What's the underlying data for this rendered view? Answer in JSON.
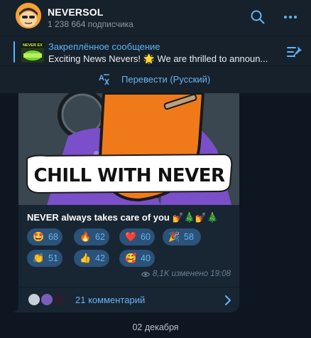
{
  "header": {
    "title": "NEVERSOL",
    "subtitle": "1 238 664 подписчика",
    "avatar_icon": "cartoon-avatar",
    "search_icon": "search-icon",
    "more_icon": "more-icon"
  },
  "pinned": {
    "label": "Закреплённое сообщение",
    "text": "Exciting News Nevers! 🌟  We are thrilled to announ...",
    "thumb_text": "NEVER EX"
  },
  "translate": {
    "label": "Перевести (Русский)"
  },
  "message": {
    "image_text": "CHILL WITH NEVER",
    "caption": "NEVER always takes care of you",
    "caption_emoji": "💅🎄💅🎄",
    "reactions": [
      {
        "emoji": "🤩",
        "count": "68"
      },
      {
        "emoji": "🔥",
        "count": "62"
      },
      {
        "emoji": "❤️",
        "count": "60"
      },
      {
        "emoji": "🎉",
        "count": "58"
      },
      {
        "emoji": "👏",
        "count": "51"
      },
      {
        "emoji": "👍",
        "count": "42"
      },
      {
        "emoji": "🥰",
        "count": "40"
      }
    ],
    "meta": "8,1K изменено 19:08",
    "comments": "21 комментарий"
  },
  "date_separator": "02 декабря",
  "colors": {
    "background": "#0e1621",
    "panel": "#17212b",
    "bubble": "#182533",
    "accent": "#6ab3f3",
    "reaction_bg": "#2b5278"
  }
}
